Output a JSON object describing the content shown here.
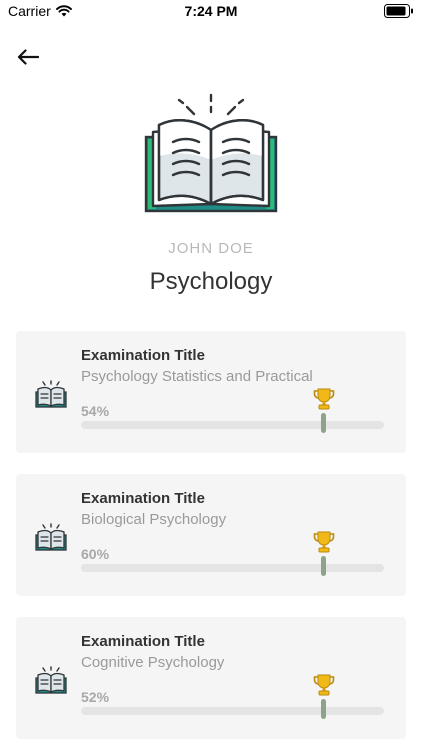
{
  "status_bar": {
    "carrier": "Carrier",
    "time": "7:24 PM"
  },
  "header": {
    "user_name": "JOHN DOE",
    "title": "Psychology"
  },
  "exams": [
    {
      "heading": "Examination Title",
      "subtitle": "Psychology Statistics and Practical",
      "percent_label": "54%"
    },
    {
      "heading": "Examination Title",
      "subtitle": "Biological Psychology",
      "percent_label": "60%"
    },
    {
      "heading": "Examination Title",
      "subtitle": "Cognitive Psychology",
      "percent_label": "52%"
    }
  ],
  "icons": {
    "back": "arrow-left-icon",
    "hero": "open-book-icon",
    "card": "book-icon",
    "trophy": "trophy-icon"
  },
  "colors": {
    "book_teal": "#1f8c86",
    "book_green": "#2dbb7a",
    "trophy_gold": "#f1b818",
    "progress_marker": "#8ba58b",
    "card_background": "#f5f5f5"
  }
}
